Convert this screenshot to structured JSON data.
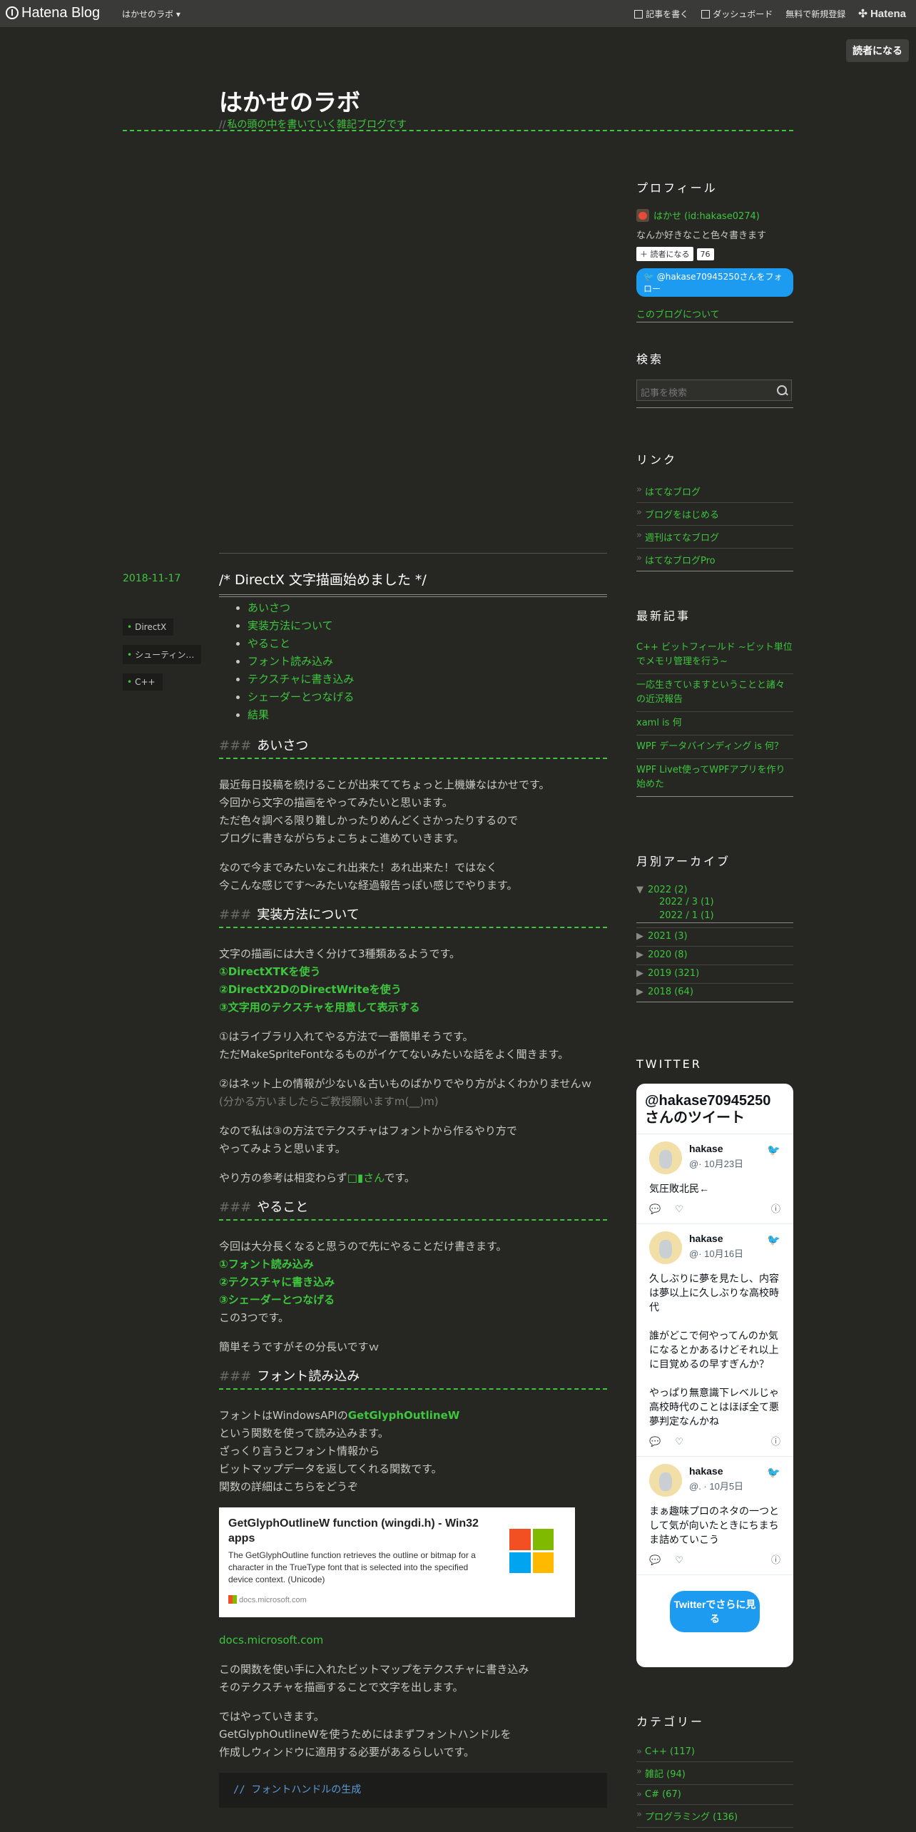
{
  "topbar": {
    "logo": "Hatena Blog",
    "blog_menu": "はかせのラボ ▾",
    "write": "記事を書く",
    "dashboard": "ダッシュボード",
    "signup": "無料で新規登録",
    "hatena": "Hatena"
  },
  "subscribe_top": "読者になる",
  "header": {
    "title": "はかせのラボ",
    "desc_prefix": "//",
    "desc": "私の頭の中を書いていく雑記ブログです"
  },
  "entry": {
    "date": "2018-11-17",
    "title": "/*  DirectX 文字描画始めました  */",
    "categories": [
      "DirectX",
      "シューティン…",
      "C++"
    ],
    "toc": [
      "あいさつ",
      "実装方法について",
      "やること",
      "フォント読み込み",
      "テクスチャに書き込み",
      "シェーダーとつなげる",
      "結果"
    ],
    "sections": {
      "s1": {
        "hash": "###",
        "heading": "あいさつ",
        "p1": [
          "最近毎日投稿を続けることが出来ててちょっと上機嫌なはかせです。",
          "今回から文字の描画をやってみたいと思います。",
          "ただ色々調べる限り難しかったりめんどくさかったりするので",
          "ブログに書きながらちょこちょこ進めていきます。"
        ],
        "p2": [
          "なので今までみたいなこれ出来た！あれ出来た！ではなく",
          "今こんな感じです～みたいな経過報告っぽい感じでやります。"
        ]
      },
      "s2": {
        "hash": "###",
        "heading": "実装方法について",
        "intro": "文字の描画には大きく分けて3種類あるようです。",
        "items": [
          "①DirectXTKを使う",
          "②DirectX2DのDirectWriteを使う",
          "③文字用のテクスチャを用意して表示する"
        ],
        "p1": [
          "①はライブラリ入れてやる方法で一番簡単そうです。",
          "ただMakeSpriteFontなるものがイケてないみたいな話をよく聞きます。"
        ],
        "p2a": "②はネット上の情報が少ない＆古いものばかりでやり方がよくわかりませんｗ",
        "p2b": "(分かる方いましたらご教授願いますm(__)m)",
        "p3": [
          "なので私は③の方法でテクスチャはフォントから作るやり方で",
          "やってみようと思います。"
        ],
        "p4_pre": "やり方の参考は相変わらず",
        "p4_link": "□▮さん",
        "p4_post": "です。"
      },
      "s3": {
        "hash": "###",
        "heading": "やること",
        "intro": "今回は大分長くなると思うので先にやることだけ書きます。",
        "items": [
          "①フォント読み込み",
          "②テクスチャに書き込み",
          "③シェーダーとつなげる"
        ],
        "outro": "この3つです。",
        "p2": "簡単そうですがその分長いですｗ"
      },
      "s4": {
        "hash": "###",
        "heading": "フォント読み込み",
        "l1_pre": "フォントはWindowsAPIの",
        "l1_fn": "GetGlyphOutlineW",
        "lines": [
          "という関数を使って読み込みます。",
          "ざっくり言うとフォント情報から",
          "ビットマップデータを返してくれる関数です。",
          "関数の詳細はこちらをどうぞ"
        ],
        "card": {
          "title": "GetGlyphOutlineW function (wingdi.h) - Win32 apps",
          "desc": "The GetGlyphOutline function retrieves the outline or bitmap for a character in the TrueType font that is selected into the specified device context. (Unicode)",
          "site": "docs.microsoft.com"
        },
        "link": "docs.microsoft.com",
        "p2": [
          "この関数を使い手に入れたビットマップをテクスチャに書き込み",
          "そのテクスチャを描画することで文字を出します。"
        ],
        "p3": [
          "ではやっていきます。",
          "GetGlyphOutlineWを使うためにはまずフォントハンドルを",
          "作成しウィンドウに適用する必要があるらしいです。"
        ],
        "code": "//  フォントハンドルの生成"
      }
    }
  },
  "sidebar": {
    "profile": {
      "title": "プロフィール",
      "name": "はかせ (id:hakase0274)",
      "bio": "なんか好きなこと色々書きます",
      "subscribe": "＋ 読者になる",
      "count": "76",
      "twitter_follow": "@hakase70945250さんをフォロー",
      "about": "このブログについて"
    },
    "search": {
      "title": "検索",
      "placeholder": "記事を検索"
    },
    "links": {
      "title": "リンク",
      "items": [
        "はてなブログ",
        "ブログをはじめる",
        "週刊はてなブログ",
        "はてなブログPro"
      ]
    },
    "recent": {
      "title": "最新記事",
      "items": [
        "C++ ビットフィールド ~ビット単位でメモリ管理を行う~",
        "一応生きていますということと諸々の近況報告",
        "xaml is 何",
        "WPF データバインディング is 何？",
        "WPF Livet使ってWPFアプリを作り始めた"
      ]
    },
    "archive": {
      "title": "月別アーカイブ",
      "open": {
        "tri": "▼",
        "label": "2022 (2)",
        "subs": [
          "2022 / 3 (1)",
          "2022 / 1 (1)"
        ]
      },
      "years": [
        {
          "tri": "▶",
          "label": "2021 (3)"
        },
        {
          "tri": "▶",
          "label": "2020 (8)"
        },
        {
          "tri": "▶",
          "label": "2019 (321)"
        },
        {
          "tri": "▶",
          "label": "2018 (64)"
        }
      ]
    },
    "twitter": {
      "title": "TWITTER",
      "header": "@hakase70945250 さんのツイート",
      "tweets": [
        {
          "name": "hakase",
          "meta": "@· 10月23日",
          "text": "気圧敗北民←"
        },
        {
          "name": "hakase",
          "meta": "@· 10月16日",
          "text": "久しぶりに夢を見たし、内容は夢以上に久しぶりな高校時代\n\n誰がどこで何やってんのか気になるとかあるけどそれ以上に目覚めるの早すぎんか？\n\nやっぱり無意識下レベルじゃ高校時代のことはほぼ全て悪夢判定なんかね"
        },
        {
          "name": "hakase",
          "meta": "@. · 10月5日",
          "text": "まぁ趣味プロのネタの一つとして気が向いたときにちまちま詰めていこう"
        }
      ],
      "more": "Twitterでさらに見る"
    },
    "categories": {
      "title": "カテゴリー",
      "items": [
        "C++ (117)",
        "雑記 (94)",
        "C# (67)",
        "プログラミング (136)"
      ]
    }
  },
  "colors": {
    "bg": "#262623",
    "accent": "#3ec63e",
    "topbar": "#3a3a38",
    "twitter": "#1d9bf0"
  }
}
